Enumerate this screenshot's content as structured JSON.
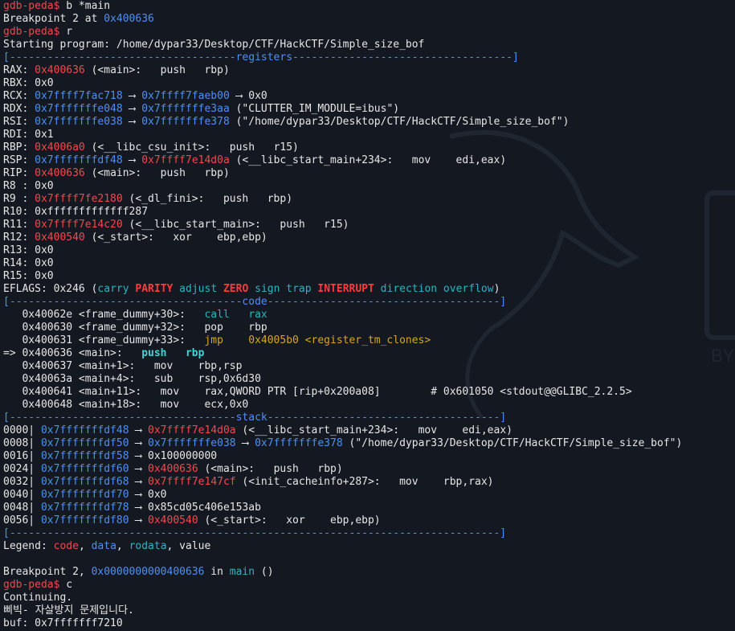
{
  "colors": {
    "background": "#141921",
    "text": "#e6e6e6",
    "red": "#f0484f",
    "blue": "#4e8ff0",
    "teal": "#2bb3c2",
    "yellow": "#d8a422",
    "flag_red": "#ff3a3a"
  },
  "terminal": {
    "lines": [
      [
        [
          "r",
          "gdb-peda$ "
        ],
        [
          "w",
          "b *main"
        ]
      ],
      [
        [
          "w",
          "Breakpoint 2 at "
        ],
        [
          "b",
          "0x400636"
        ]
      ],
      [
        [
          "r",
          "gdb-peda$ "
        ],
        [
          "w",
          "r"
        ]
      ],
      [
        [
          "w",
          "Starting program: /home/dypar33/Desktop/CTF/HackCTF/Simple_size_bof"
        ]
      ],
      [
        [
          "b",
          "[------------------------------------"
        ],
        [
          "b",
          "registers"
        ],
        [
          "b",
          "-----------------------------------]"
        ]
      ],
      [
        [
          "g",
          "RAX: "
        ],
        [
          "r",
          "0x400636"
        ],
        [
          "w",
          " (<main>:\tpush   rbp)"
        ]
      ],
      [
        [
          "g",
          "RBX: "
        ],
        [
          "w",
          "0x0"
        ]
      ],
      [
        [
          "g",
          "RCX: "
        ],
        [
          "b",
          "0x7ffff7fac718"
        ],
        [
          "w",
          " --> "
        ],
        [
          "b",
          "0x7ffff7faeb00"
        ],
        [
          "w",
          " --> 0x0"
        ]
      ],
      [
        [
          "g",
          "RDX: "
        ],
        [
          "b",
          "0x7fffffffe048"
        ],
        [
          "w",
          " --> "
        ],
        [
          "b",
          "0x7fffffffe3aa"
        ],
        [
          "w",
          " (\"CLUTTER_IM_MODULE=ibus\")"
        ]
      ],
      [
        [
          "g",
          "RSI: "
        ],
        [
          "b",
          "0x7fffffffe038"
        ],
        [
          "w",
          " --> "
        ],
        [
          "b",
          "0x7fffffffe378"
        ],
        [
          "w",
          " (\"/home/dypar33/Desktop/CTF/HackCTF/Simple_size_bof\")"
        ]
      ],
      [
        [
          "g",
          "RDI: "
        ],
        [
          "w",
          "0x1"
        ]
      ],
      [
        [
          "g",
          "RBP: "
        ],
        [
          "r",
          "0x4006a0"
        ],
        [
          "w",
          " (<__libc_csu_init>:\tpush   r15)"
        ]
      ],
      [
        [
          "g",
          "RSP: "
        ],
        [
          "b",
          "0x7fffffffdf48"
        ],
        [
          "w",
          " --> "
        ],
        [
          "r",
          "0x7ffff7e14d0a"
        ],
        [
          "w",
          " (<__libc_start_main+234>:\tmov    edi,eax)"
        ]
      ],
      [
        [
          "g",
          "RIP: "
        ],
        [
          "r",
          "0x400636"
        ],
        [
          "w",
          " (<main>:\tpush   rbp)"
        ]
      ],
      [
        [
          "g",
          "R8 : "
        ],
        [
          "w",
          "0x0"
        ]
      ],
      [
        [
          "g",
          "R9 : "
        ],
        [
          "r",
          "0x7ffff7fe2180"
        ],
        [
          "w",
          " (<_dl_fini>:\tpush   rbp)"
        ]
      ],
      [
        [
          "g",
          "R10: "
        ],
        [
          "w",
          "0xfffffffffffff287"
        ]
      ],
      [
        [
          "g",
          "R11: "
        ],
        [
          "r",
          "0x7ffff7e14c20"
        ],
        [
          "w",
          " (<__libc_start_main>:\tpush   r15)"
        ]
      ],
      [
        [
          "g",
          "R12: "
        ],
        [
          "r",
          "0x400540"
        ],
        [
          "w",
          " (<_start>:\txor    ebp,ebp)"
        ]
      ],
      [
        [
          "g",
          "R13: "
        ],
        [
          "w",
          "0x0"
        ]
      ],
      [
        [
          "g",
          "R14: "
        ],
        [
          "w",
          "0x0"
        ]
      ],
      [
        [
          "g",
          "R15: "
        ],
        [
          "w",
          "0x0"
        ]
      ],
      [
        [
          "g",
          "EFLAGS: "
        ],
        [
          "w",
          "0x246 ("
        ],
        [
          "t",
          "carry "
        ],
        [
          "rb",
          "PARITY"
        ],
        [
          "t",
          " adjust "
        ],
        [
          "rb",
          "ZERO"
        ],
        [
          "t",
          " sign trap "
        ],
        [
          "rb",
          "INTERRUPT"
        ],
        [
          "t",
          " direction overflow"
        ],
        [
          "w",
          ")"
        ]
      ],
      [
        [
          "b",
          "[-------------------------------------"
        ],
        [
          "b",
          "code"
        ],
        [
          "b",
          "-------------------------------------]"
        ]
      ],
      [
        [
          "w",
          "   0x40062e <frame_dummy+30>:\t"
        ],
        [
          "t",
          "call   rax"
        ]
      ],
      [
        [
          "w",
          "   0x400630 <frame_dummy+32>:\tpop    rbp"
        ]
      ],
      [
        [
          "w",
          "   0x400631 <frame_dummy+33>:\t"
        ],
        [
          "y",
          "jmp    0x4005b0 <register_tm_clones>"
        ]
      ],
      [
        [
          "w",
          "=> 0x400636 <main>:\t"
        ],
        [
          "tb",
          "push   rbp"
        ]
      ],
      [
        [
          "w",
          "   0x400637 <main+1>:\tmov    rbp,rsp"
        ]
      ],
      [
        [
          "w",
          "   0x40063a <main+4>:\tsub    rsp,0x6d30"
        ]
      ],
      [
        [
          "w",
          "   0x400641 <main+11>:\tmov    rax,QWORD PTR [rip+0x200a08]        # 0x601050 <stdout@@GLIBC_2.2.5>"
        ]
      ],
      [
        [
          "w",
          "   0x400648 <main+18>:\tmov    ecx,0x0"
        ]
      ],
      [
        [
          "b",
          "[------------------------------------"
        ],
        [
          "b",
          "stack"
        ],
        [
          "b",
          "-------------------------------------]"
        ]
      ],
      [
        [
          "w",
          "0000| "
        ],
        [
          "b",
          "0x7fffffffdf48"
        ],
        [
          "w",
          " --> "
        ],
        [
          "r",
          "0x7ffff7e14d0a"
        ],
        [
          "w",
          " (<__libc_start_main+234>:\tmov    edi,eax)"
        ]
      ],
      [
        [
          "w",
          "0008| "
        ],
        [
          "b",
          "0x7fffffffdf50"
        ],
        [
          "w",
          " --> "
        ],
        [
          "b",
          "0x7fffffffe038"
        ],
        [
          "w",
          " --> "
        ],
        [
          "b",
          "0x7fffffffe378"
        ],
        [
          "w",
          " (\"/home/dypar33/Desktop/CTF/HackCTF/Simple_size_bof\")"
        ]
      ],
      [
        [
          "w",
          "0016| "
        ],
        [
          "b",
          "0x7fffffffdf58"
        ],
        [
          "w",
          " --> 0x100000000"
        ]
      ],
      [
        [
          "w",
          "0024| "
        ],
        [
          "b",
          "0x7fffffffdf60"
        ],
        [
          "w",
          " --> "
        ],
        [
          "r",
          "0x400636"
        ],
        [
          "w",
          " (<main>:\tpush   rbp)"
        ]
      ],
      [
        [
          "w",
          "0032| "
        ],
        [
          "b",
          "0x7fffffffdf68"
        ],
        [
          "w",
          " --> "
        ],
        [
          "r",
          "0x7ffff7e147cf"
        ],
        [
          "w",
          " (<init_cacheinfo+287>:\tmov    rbp,rax)"
        ]
      ],
      [
        [
          "w",
          "0040| "
        ],
        [
          "b",
          "0x7fffffffdf70"
        ],
        [
          "w",
          " --> 0x0"
        ]
      ],
      [
        [
          "w",
          "0048| "
        ],
        [
          "b",
          "0x7fffffffdf78"
        ],
        [
          "w",
          " --> 0x85cd05c406e153ab"
        ]
      ],
      [
        [
          "w",
          "0056| "
        ],
        [
          "b",
          "0x7fffffffdf80"
        ],
        [
          "w",
          " --> "
        ],
        [
          "r",
          "0x400540"
        ],
        [
          "w",
          " (<_start>:\txor    ebp,ebp)"
        ]
      ],
      [
        [
          "b",
          "[------------------------------------------------------------------------------]"
        ]
      ],
      [
        [
          "w",
          "Legend: "
        ],
        [
          "r",
          "code"
        ],
        [
          "w",
          ", "
        ],
        [
          "b",
          "data"
        ],
        [
          "w",
          ", "
        ],
        [
          "t",
          "rodata"
        ],
        [
          "w",
          ", value"
        ]
      ],
      [
        [
          "w",
          ""
        ]
      ],
      [
        [
          "w",
          "Breakpoint 2, "
        ],
        [
          "b",
          "0x0000000000400636"
        ],
        [
          "w",
          " in "
        ],
        [
          "t",
          "main"
        ],
        [
          "w",
          " ()"
        ]
      ],
      [
        [
          "r",
          "gdb-peda$ "
        ],
        [
          "w",
          "c"
        ]
      ],
      [
        [
          "w",
          "Continuing."
        ]
      ],
      [
        [
          "w",
          "삐빅- 자살방지 문제입니다."
        ]
      ],
      [
        [
          "w",
          "buf: 0x7fffffff7210"
        ]
      ]
    ]
  }
}
